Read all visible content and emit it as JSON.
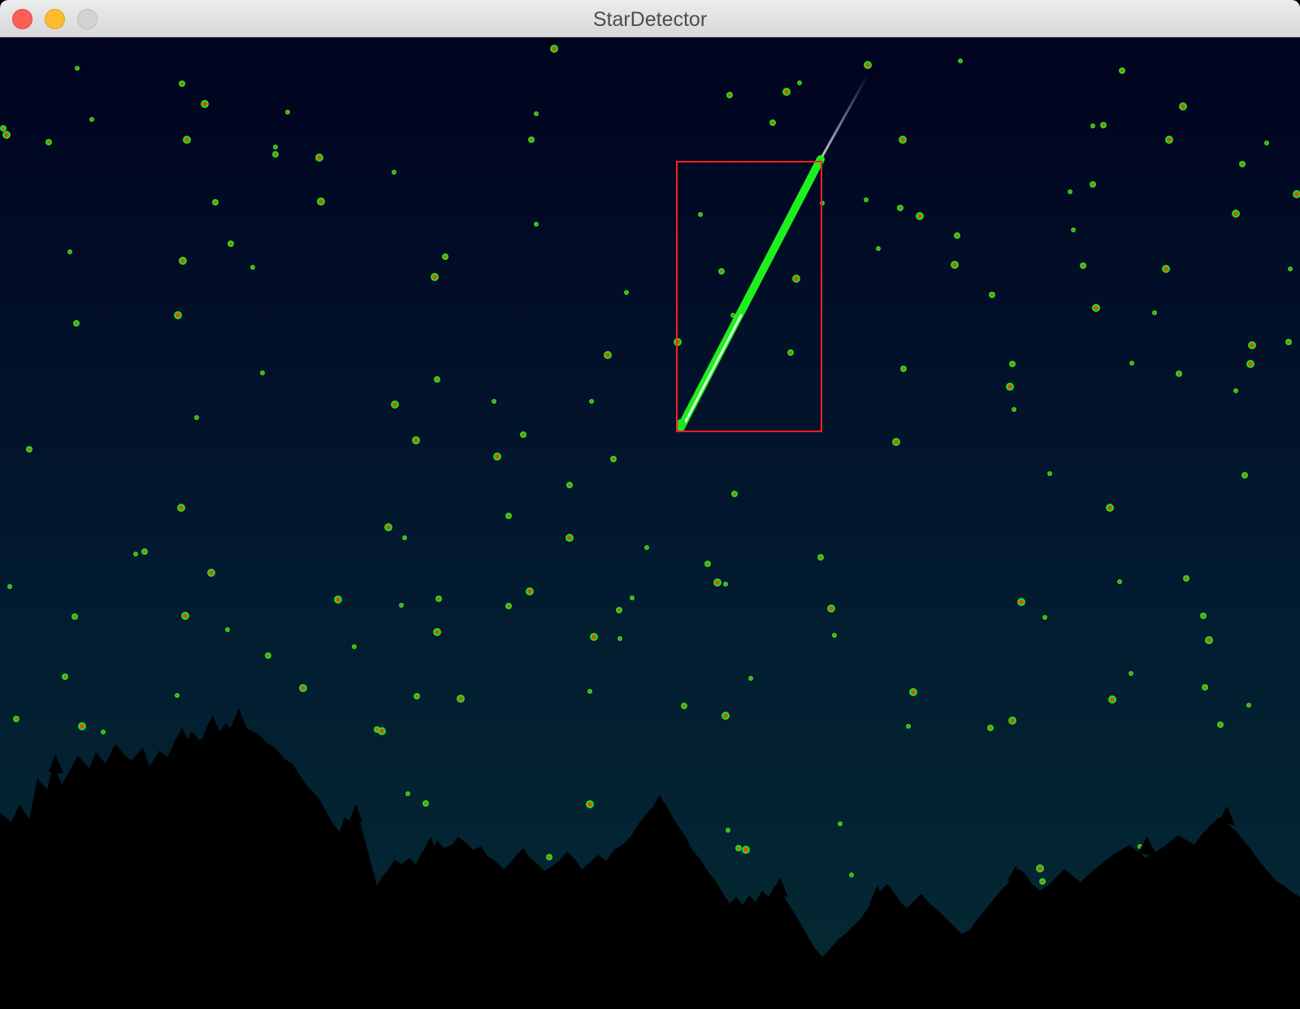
{
  "window": {
    "title": "StarDetector",
    "controls": [
      "close-icon",
      "minimize-icon",
      "zoom-icon"
    ]
  },
  "scene": {
    "sky_top_color": "#01031f",
    "sky_bottom_color": "#042a33",
    "tree_color": "#000000",
    "star_marker_color": "#1ee01e",
    "star_center_color": "#e04a14",
    "detection_box_color": "#ff2020",
    "meteor_track_color": "#1eef1e"
  }
}
